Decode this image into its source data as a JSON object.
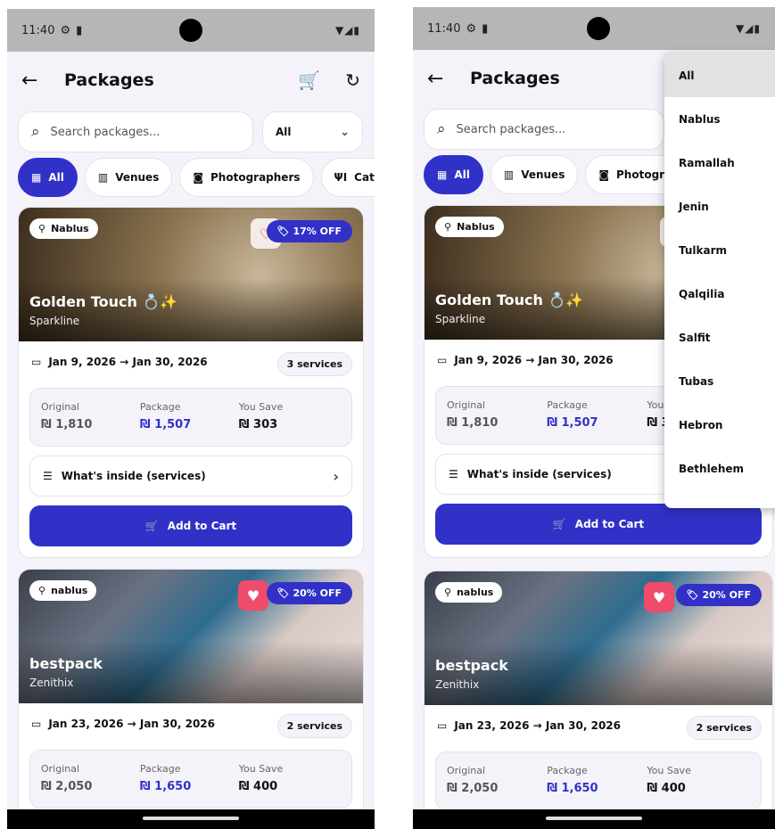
{
  "status": {
    "time": "11:40"
  },
  "header": {
    "back": "←",
    "title": "Packages",
    "cart": "🛒",
    "refresh": "↻"
  },
  "search": {
    "placeholder": "Search packages..."
  },
  "filter": {
    "selected": "All",
    "chevron": "⌄"
  },
  "chips": [
    "All",
    "Venues",
    "Photographers",
    "Catering"
  ],
  "chips_right_visible": [
    "All",
    "Venues",
    "Photographers"
  ],
  "cards": [
    {
      "location": "Nablus",
      "discount": "17% OFF",
      "name": "Golden Touch 💍✨",
      "vendor": "Sparkline",
      "dates": "Jan 9, 2026 → Jan 30, 2026",
      "services": "3 services",
      "original_label": "Original",
      "original": "₪ 1,810",
      "package_label": "Package",
      "package": "₪ 1,507",
      "save_label": "You Save",
      "save": "₪ 303",
      "inside": "What's inside (services)",
      "add_to_cart": "Add to Cart",
      "favorite": false
    },
    {
      "location": "nablus",
      "discount": "20% OFF",
      "name": "bestpack",
      "vendor": "Zenithix",
      "dates": "Jan 23, 2026 → Jan 30, 2026",
      "services": "2 services",
      "original_label": "Original",
      "original": "₪ 2,050",
      "package_label": "Package",
      "package": "₪ 1,650",
      "save_label": "You Save",
      "save": "₪ 400",
      "favorite": true
    }
  ],
  "dropdown_options": [
    "All",
    "Nablus",
    "Ramallah",
    "Jenin",
    "Tulkarm",
    "Qalqilia",
    "Salfit",
    "Tubas",
    "Hebron",
    "Bethlehem"
  ],
  "colors": {
    "accent": "#3131c8",
    "favorite": "#ef4b6b",
    "background": "#f4f3fa"
  }
}
